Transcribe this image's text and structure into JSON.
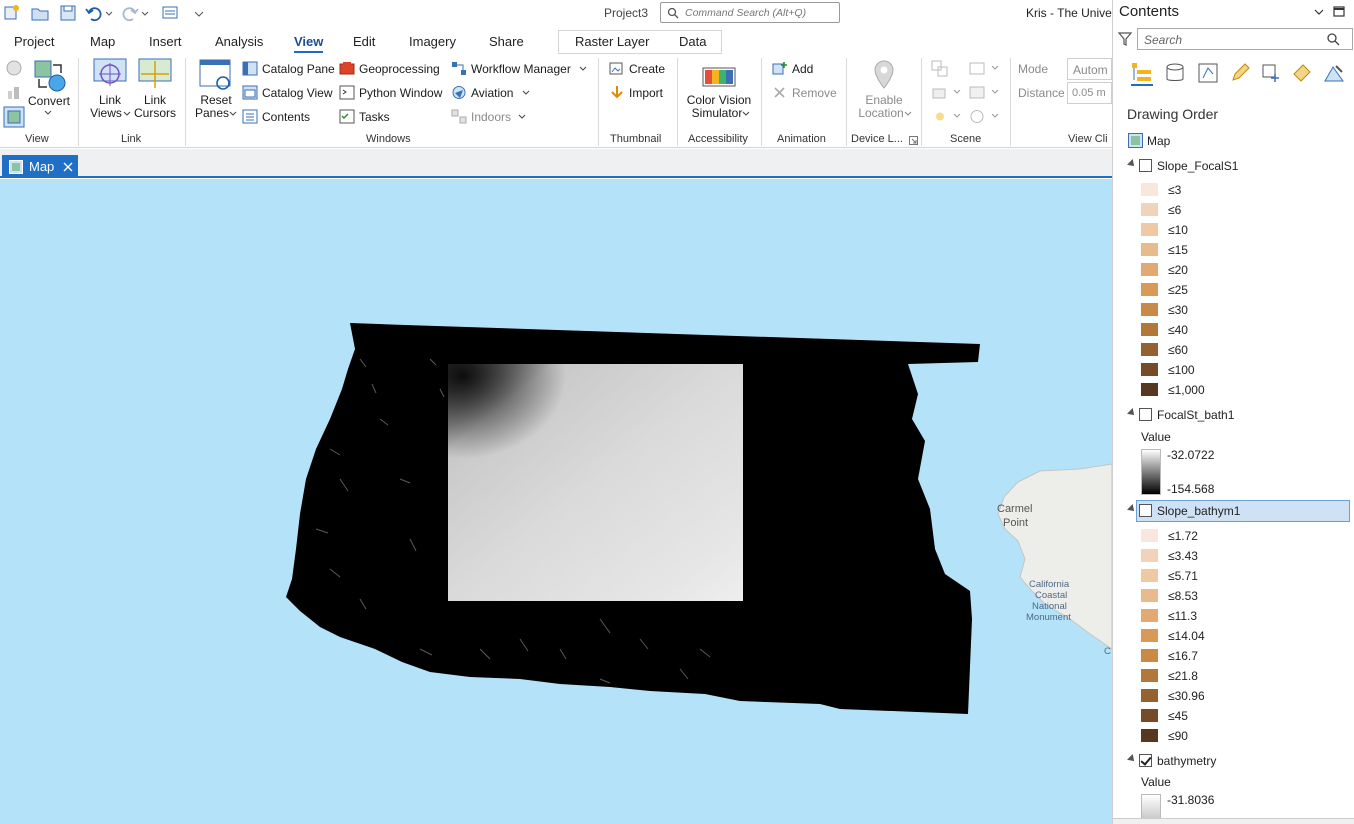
{
  "window": {
    "title": "Project3",
    "user": "Kris - The Univer"
  },
  "command_search": {
    "placeholder": "Command Search (Alt+Q)"
  },
  "ribbon_tabs": [
    "Project",
    "Map",
    "Insert",
    "Analysis",
    "View",
    "Edit",
    "Imagery",
    "Share"
  ],
  "active_tab": "View",
  "context_tabs": [
    "Raster Layer",
    "Data"
  ],
  "ribbon": {
    "view": {
      "convert": "Convert",
      "group": "View"
    },
    "link": {
      "link_views_1": "Link",
      "link_views_2": "Views",
      "link_cursors_1": "Link",
      "link_cursors_2": "Cursors",
      "group": "Link"
    },
    "windows": {
      "reset_1": "Reset",
      "reset_2": "Panes",
      "catalog_pane": "Catalog Pane",
      "catalog_view": "Catalog View",
      "contents": "Contents",
      "geoprocessing": "Geoprocessing",
      "python_window": "Python Window",
      "tasks": "Tasks",
      "workflow_manager": "Workflow Manager",
      "aviation": "Aviation",
      "indoors": "Indoors",
      "group": "Windows"
    },
    "thumbnail": {
      "create": "Create",
      "import": "Import",
      "group": "Thumbnail"
    },
    "accessibility": {
      "cvs_1": "Color Vision",
      "cvs_2": "Simulator",
      "group": "Accessibility"
    },
    "animation": {
      "add": "Add",
      "remove": "Remove",
      "group": "Animation"
    },
    "device": {
      "enable_1": "Enable",
      "enable_2": "Location",
      "group": "Device L..."
    },
    "scene": {
      "group": "Scene"
    },
    "viewclip": {
      "mode_label": "Mode",
      "mode_value": "Autom",
      "distance_label": "Distance",
      "distance_value": "0.05 m",
      "group": "View Cli"
    }
  },
  "view_tab": {
    "label": "Map"
  },
  "map": {
    "labels": {
      "carmel_1": "Carmel",
      "carmel_2": "Point",
      "ca_1": "California",
      "ca_2": "Coastal",
      "ca_3": "National",
      "ca_4": "Monument",
      "edge": "C"
    }
  },
  "contents": {
    "title": "Contents",
    "search_placeholder": "Search",
    "drawing_order": "Drawing Order",
    "map_label": "Map",
    "layers": [
      {
        "name": "Slope_FocalS1",
        "checked": false,
        "classes": [
          "≤3",
          "≤6",
          "≤10",
          "≤15",
          "≤20",
          "≤25",
          "≤30",
          "≤40",
          "≤60",
          "≤100",
          "≤1,000"
        ]
      },
      {
        "name": "FocalSt_bath1",
        "checked": false,
        "value_label": "Value",
        "max": "-32.0722",
        "min": "-154.568"
      },
      {
        "name": "Slope_bathym1",
        "checked": false,
        "selected": true,
        "classes": [
          "≤1.72",
          "≤3.43",
          "≤5.71",
          "≤8.53",
          "≤11.3",
          "≤14.04",
          "≤16.7",
          "≤21.8",
          "≤30.96",
          "≤45",
          "≤90"
        ]
      },
      {
        "name": "bathymetry",
        "checked": true,
        "value_label": "Value",
        "max": "-31.8036"
      }
    ],
    "ramp_colors": [
      "#f9e6dc",
      "#f2d2b8",
      "#eec9a4",
      "#e8bb8c",
      "#e2aa72",
      "#d99a58",
      "#c98a45",
      "#b2783a",
      "#946231",
      "#764c28",
      "#573720"
    ]
  }
}
